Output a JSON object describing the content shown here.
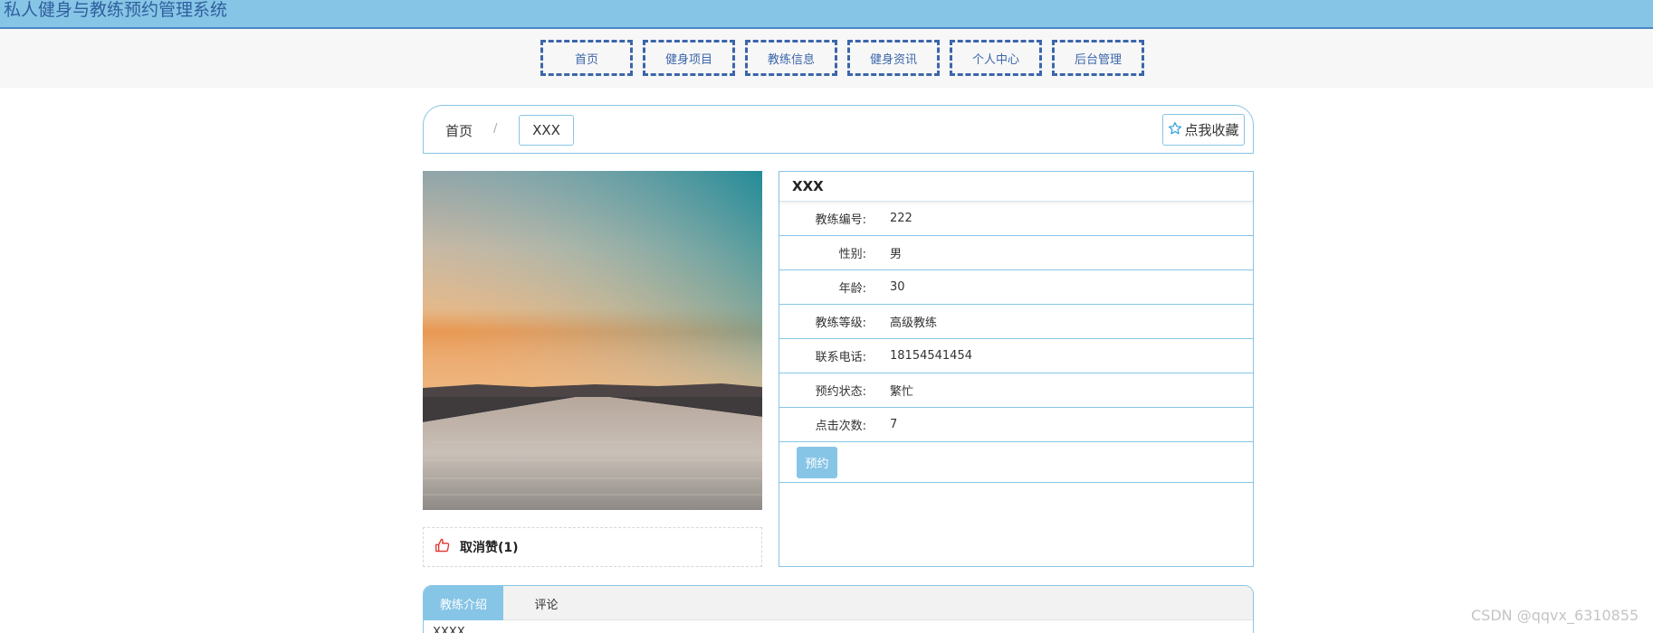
{
  "header": {
    "title": "私人健身与教练预约管理系统"
  },
  "nav": {
    "items": [
      {
        "label": "首页"
      },
      {
        "label": "健身项目"
      },
      {
        "label": "教练信息"
      },
      {
        "label": "健身资讯"
      },
      {
        "label": "个人中心"
      },
      {
        "label": "后台管理"
      }
    ]
  },
  "breadcrumb": {
    "home": "首页",
    "separator": "/",
    "current": "XXX"
  },
  "favorite": {
    "label": "点我收藏",
    "icon": "star-outline-icon"
  },
  "photo": {
    "alt_icon": "landscape-photo"
  },
  "like": {
    "label": "取消赞(1)",
    "icon": "thumbs-up-icon"
  },
  "details": {
    "name": "XXX",
    "rows": [
      {
        "label": "教练编号:",
        "value": "222"
      },
      {
        "label": "性别:",
        "value": "男"
      },
      {
        "label": "年龄:",
        "value": "30"
      },
      {
        "label": "教练等级:",
        "value": "高级教练"
      },
      {
        "label": "联系电话:",
        "value": "18154541454"
      },
      {
        "label": "预约状态:",
        "value": "繁忙"
      },
      {
        "label": "点击次数:",
        "value": "7"
      }
    ],
    "book_label": "预约"
  },
  "tabs": {
    "items": [
      {
        "label": "教练介绍"
      },
      {
        "label": "评论"
      }
    ],
    "content": "XXXX"
  },
  "watermark": "CSDN @qqvx_6310855",
  "colors": {
    "accent": "#87c5e6",
    "nav_border": "#3b66aa",
    "title": "#2f5f9e"
  }
}
